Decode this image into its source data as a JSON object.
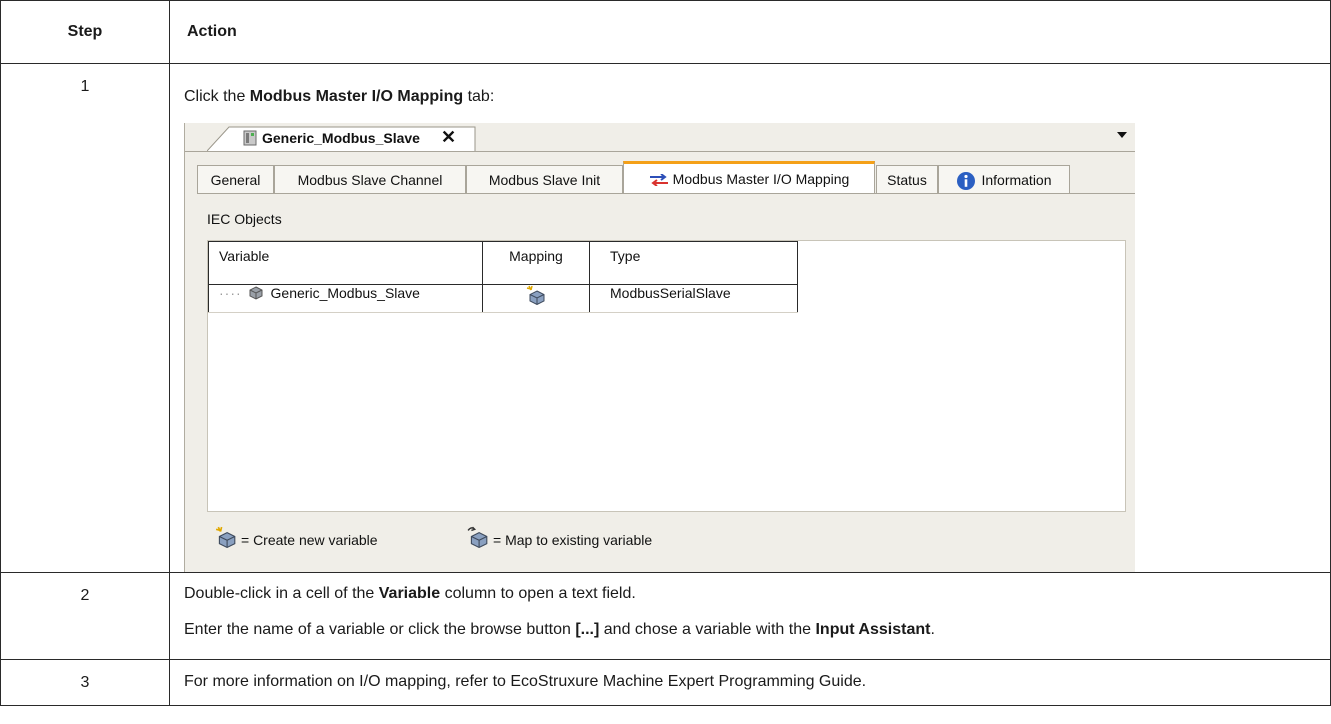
{
  "table": {
    "header_step": "Step",
    "header_action": "Action"
  },
  "row1": {
    "step": "1",
    "text_before": "Click the ",
    "text_bold": "Modbus Master I/O Mapping",
    "text_after": " tab:"
  },
  "screenshot": {
    "doc_tab_title": "Generic_Modbus_Slave",
    "close_glyph": "✕",
    "tabs": [
      "General",
      "Modbus Slave Channel",
      "Modbus Slave Init",
      "Modbus Master I/O Mapping",
      "Status",
      "Information"
    ],
    "section_label": "IEC Objects",
    "columns": [
      "Variable",
      "Mapping",
      "Type"
    ],
    "rows": [
      {
        "variable": "Generic_Modbus_Slave",
        "type": "ModbusSerialSlave",
        "mapping_icon": "create-new-variable-icon"
      }
    ],
    "legend": {
      "create": "= Create new variable",
      "map": "= Map to existing variable"
    }
  },
  "row2": {
    "step": "2",
    "p1_before": "Double-click in a cell of the ",
    "p1_bold": "Variable",
    "p1_after": " column to open a text field.",
    "p2_before": "Enter the name of a variable or click the browse button ",
    "p2_bold1": "[...]",
    "p2_mid": " and chose a variable with the ",
    "p2_bold2": "Input Assistant",
    "p2_after": "."
  },
  "row3": {
    "step": "3",
    "text": "For more information on I/O mapping, refer to EcoStruxure Machine Expert Programming Guide."
  }
}
